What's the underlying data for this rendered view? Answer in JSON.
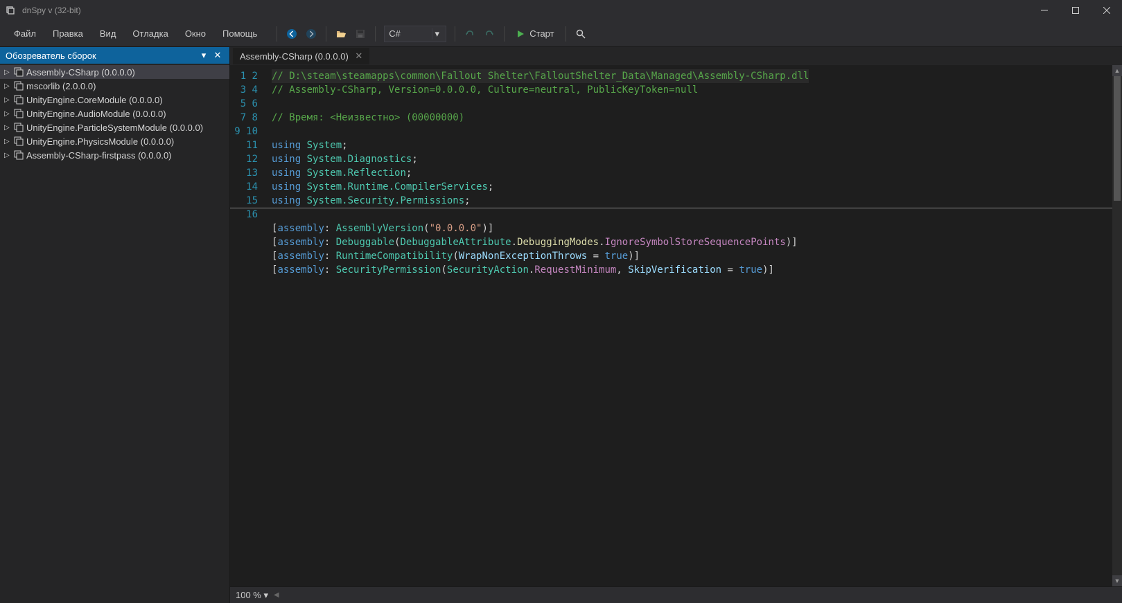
{
  "window": {
    "title": "dnSpy v (32-bit)"
  },
  "menu": {
    "file": "Файл",
    "edit": "Правка",
    "view": "Вид",
    "debug": "Отладка",
    "window": "Окно",
    "help": "Помощь"
  },
  "toolbar": {
    "language": "C#",
    "start": "Старт"
  },
  "sidebar": {
    "title": "Обозреватель сборок",
    "items": [
      {
        "label": "Assembly-CSharp (0.0.0.0)",
        "selected": true
      },
      {
        "label": "mscorlib (2.0.0.0)",
        "selected": false
      },
      {
        "label": "UnityEngine.CoreModule (0.0.0.0)",
        "selected": false
      },
      {
        "label": "UnityEngine.AudioModule (0.0.0.0)",
        "selected": false
      },
      {
        "label": "UnityEngine.ParticleSystemModule (0.0.0.0)",
        "selected": false
      },
      {
        "label": "UnityEngine.PhysicsModule (0.0.0.0)",
        "selected": false
      },
      {
        "label": "Assembly-CSharp-firstpass (0.0.0.0)",
        "selected": false
      }
    ]
  },
  "tabs": [
    {
      "label": "Assembly-CSharp (0.0.0.0)"
    }
  ],
  "code": {
    "line1": "// D:\\steam\\steamapps\\common\\Fallout Shelter\\FalloutShelter_Data\\Managed\\Assembly-CSharp.dll",
    "line2": "// Assembly-CSharp, Version=0.0.0.0, Culture=neutral, PublicKeyToken=null",
    "line4": "// Время: <Неизвестно> (00000000)",
    "kw_using": "using",
    "ns_system": "System",
    "ns_diag": "System.Diagnostics",
    "ns_refl": "System.Reflection",
    "ns_rcs": "System.Runtime.CompilerServices",
    "ns_sec": "System.Security.Permissions",
    "kw_assembly": "assembly",
    "t_assemblyversion": "AssemblyVersion",
    "s_version": "\"0.0.0.0\"",
    "t_debuggable": "Debuggable",
    "t_debuggableattr": "DebuggableAttribute",
    "m_debugmodes": "DebuggingModes",
    "m_ignoresymbol": "IgnoreSymbolStoreSequencePoints",
    "t_runtimecompat": "RuntimeCompatibility",
    "p_wrapnon": "WrapNonExceptionThrows",
    "kw_true": "true",
    "t_secperm": "SecurityPermission",
    "t_secaction": "SecurityAction",
    "m_reqmin": "RequestMinimum",
    "p_skipver": "SkipVerification"
  },
  "status": {
    "zoom": "100 %"
  }
}
